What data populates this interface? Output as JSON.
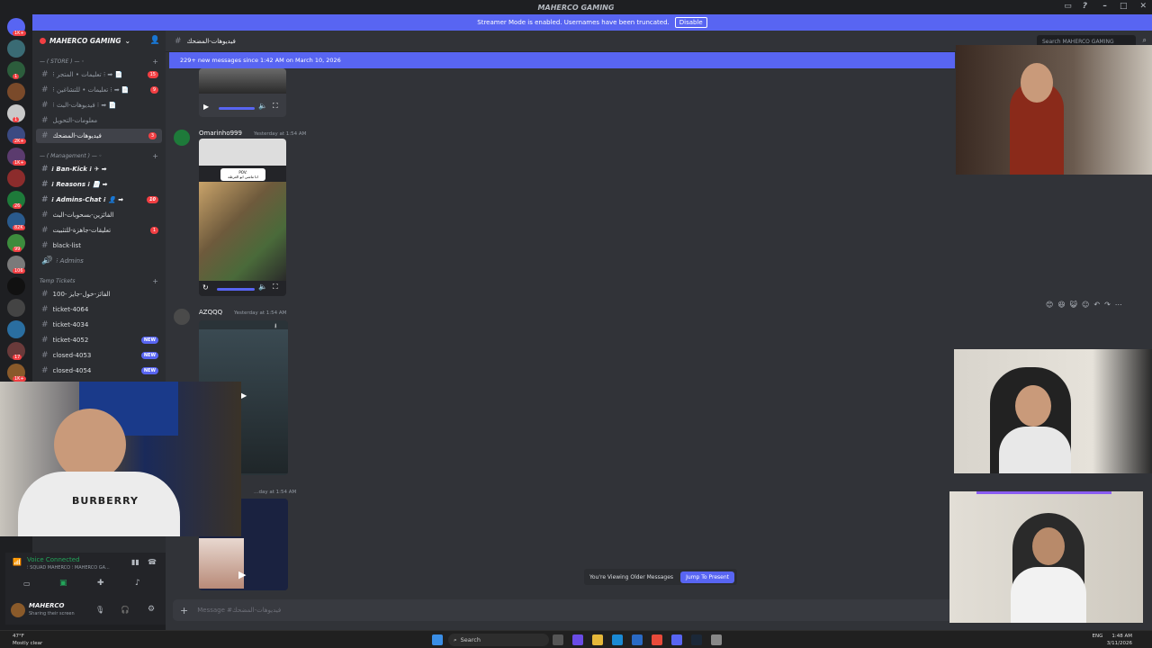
{
  "window": {
    "title": "MAHERCO GAMING"
  },
  "banner": {
    "text": "Streamer Mode is enabled. Usernames have been truncated.",
    "button": "Disable"
  },
  "server_rail": {
    "badges": [
      "1K+",
      "1",
      "1",
      "1",
      "2K+",
      "1K+",
      "7",
      "1K+",
      "26",
      "82K",
      "99",
      "1",
      "106",
      "1",
      "17",
      "1K+"
    ]
  },
  "sidebar": {
    "server_name": "MAHERCO GAMING",
    "categories": {
      "store": "— ( STORE ) — ◦",
      "management": "— ( Management ) — ◦",
      "temp": "Temp Tickets"
    },
    "channels": [
      {
        "label": "⁝ تعليمات • المتجر ⁝ ➡ 📄",
        "badge": "15"
      },
      {
        "label": "⁝ تعليمات • للتشاغين ⁝ ➡ 📄",
        "badge": "9"
      },
      {
        "label": "⁝ فيديوهات-البث ⁝ ➡ 📄",
        "badge": ""
      },
      {
        "label": "معلومات-التحويل",
        "badge": ""
      },
      {
        "label": "فيديوهات-المضحك",
        "badge": "3"
      }
    ],
    "mgmt_channels": [
      {
        "label": "⁝ Ban-Kick ⁝ ✈ ➡",
        "badge": ""
      },
      {
        "label": "⁝ Reasons ⁝ 📄 ➡",
        "badge": ""
      },
      {
        "label": "⁝ Admins-Chat ⁝ 👤 ➡",
        "badge": "10"
      },
      {
        "label": "الفائزين-بسحوبات-البث",
        "badge": ""
      },
      {
        "label": "تعليقات-جاهزة-للتثبيت",
        "badge": "1"
      },
      {
        "label": "black-list",
        "badge": ""
      },
      {
        "label": "⁝ Admins",
        "badge": ""
      }
    ],
    "ticket_channels": [
      {
        "label": "100- الفائز-خول-جايز",
        "badge": ""
      },
      {
        "label": "ticket-4064",
        "badge": ""
      },
      {
        "label": "ticket-4034",
        "badge": ""
      },
      {
        "label": "ticket-4052",
        "badge": "NEW"
      },
      {
        "label": "closed-4053",
        "badge": "NEW"
      },
      {
        "label": "closed-4054",
        "badge": "NEW"
      }
    ]
  },
  "voice": {
    "status": "Voice Connected",
    "channel": "⁝ SQUAD MAHERCO ⁝ MAHERCO GA..."
  },
  "user": {
    "name": "MAHERCO",
    "status": "Sharing their screen"
  },
  "chat": {
    "channel_name": "فيديوهات-المضحك",
    "search_placeholder": "Search MAHERCO GAMING",
    "new_messages": "229+ new messages since 1:42 AM on March 10, 2026",
    "messages": [
      {
        "author": "Omarinho999",
        "time": "Yesterday at 1:54 AM"
      },
      {
        "author": "AZQQQ",
        "time": "Yesterday at 1:54 AM"
      },
      {
        "author": "",
        "time": "…day at 1:54 AM"
      }
    ],
    "video_caption": "POV:\nانا ماشي ابو العرطه",
    "viewing_older": "You're Viewing Older Messages",
    "jump_button": "Jump To Present",
    "composer_placeholder": "Message #فيديوهات-المضحك"
  },
  "cam_shirt_text": "BURBERRY",
  "taskbar": {
    "weather_temp": "47°F",
    "weather_desc": "Mostly clear",
    "search": "Search",
    "lang": "ENG",
    "time": "1:48 AM",
    "date": "3/11/2026"
  }
}
